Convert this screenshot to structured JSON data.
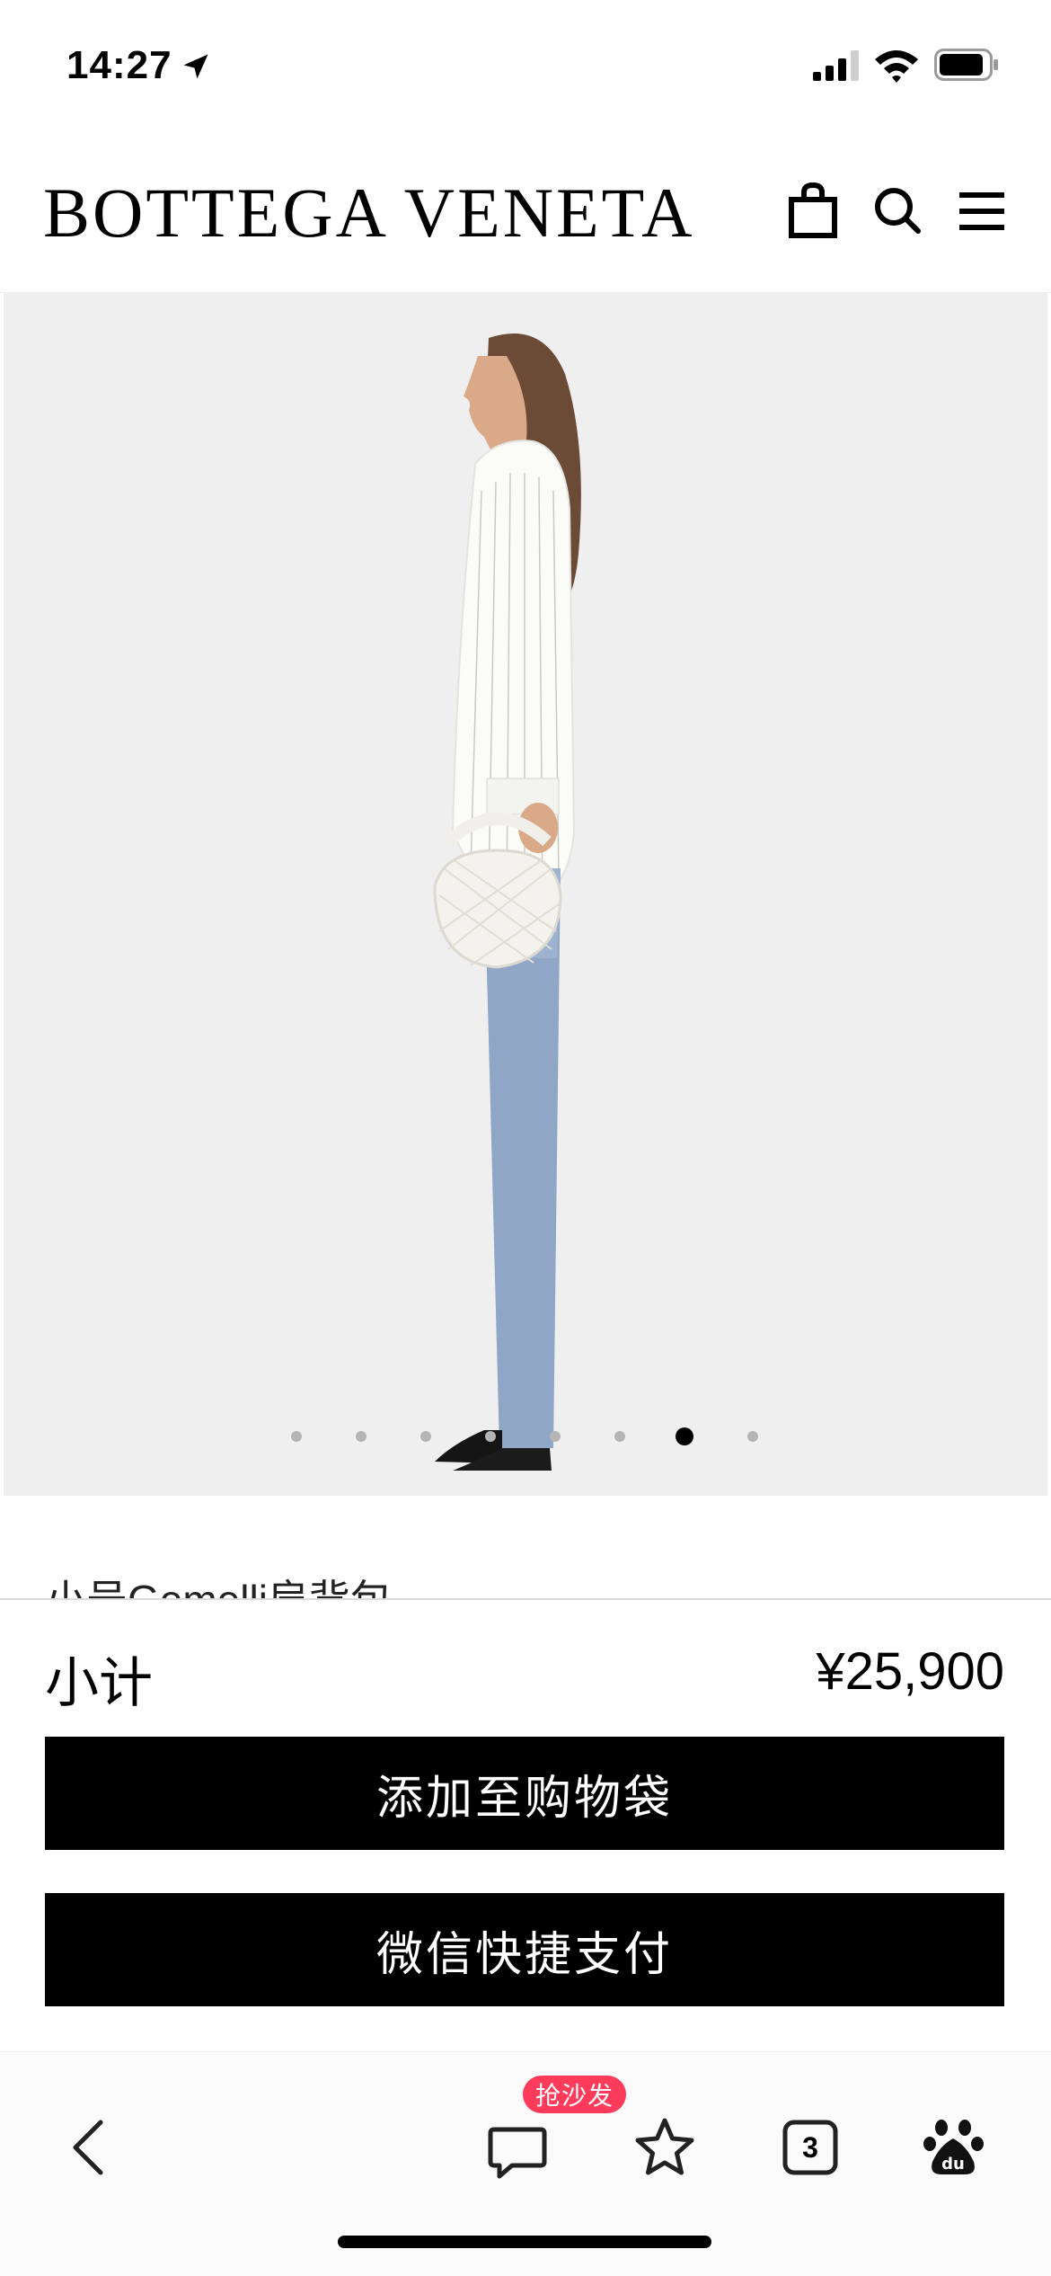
{
  "status_bar": {
    "time": "14:27",
    "icons": [
      "location-arrow-icon",
      "cellular-signal-icon",
      "wifi-icon",
      "battery-icon"
    ]
  },
  "header": {
    "brand": "BOTTEGA VENETA",
    "icons": [
      "shopping-bag-icon",
      "search-icon",
      "hamburger-menu-icon"
    ]
  },
  "gallery": {
    "image": "model-with-woven-hobo-bag",
    "total_slides": 8,
    "active_slide": 7
  },
  "product": {
    "name": "小号Gemelli肩背包"
  },
  "purchase": {
    "subtotal_label": "小计",
    "subtotal_value": "¥25,900",
    "add_to_bag_label": "添加至购物袋",
    "wechat_pay_label": "微信快捷支付"
  },
  "toolbar": {
    "hot_badge": "抢沙发",
    "tabs_count": "3",
    "icons": [
      "back-chevron-icon",
      "comment-icon",
      "star-icon",
      "tabs-icon",
      "baidu-paw-icon"
    ]
  },
  "colors": {
    "accent": "#000000",
    "gallery_bg": "#efefef",
    "badge": "#ff3b5c"
  }
}
